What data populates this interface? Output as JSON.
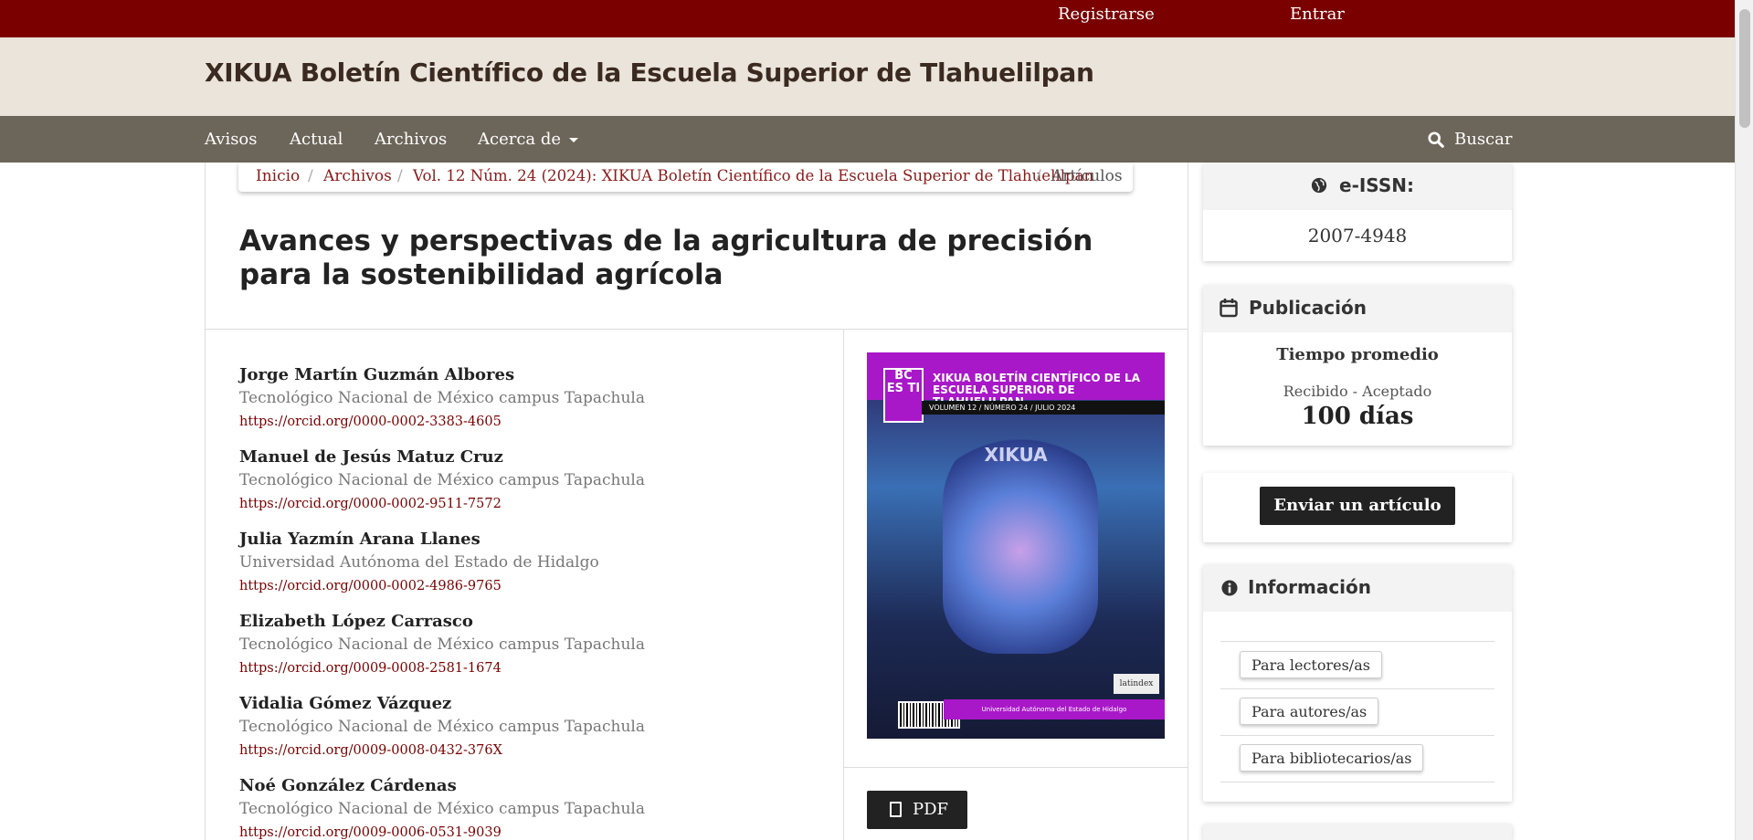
{
  "userbar": {
    "register": "Registrarse",
    "login": "Entrar"
  },
  "header": {
    "title": "XIKUA Boletín Científico de la Escuela Superior de Tlahuelilpan"
  },
  "nav": {
    "items": [
      "Avisos",
      "Actual",
      "Archivos",
      "Acerca de"
    ],
    "search": "Buscar"
  },
  "breadcrumb": {
    "home": "Inicio",
    "archives": "Archivos",
    "issue": "Vol. 12 Núm. 24 (2024): XIKUA Boletín Científico de la Escuela Superior de Tlahuelilpan",
    "current": "Artículos",
    "separator": "/"
  },
  "article": {
    "title": "Avances y perspectivas de la agricultura de precisión para la sostenibilidad agrícola",
    "authors": [
      {
        "name": "Jorge Martín Guzmán Albores",
        "affiliation": "Tecnológico Nacional de México campus Tapachula",
        "orcid": "https://orcid.org/0000-0002-3383-4605"
      },
      {
        "name": "Manuel de Jesús Matuz Cruz",
        "affiliation": "Tecnológico Nacional de México campus Tapachula",
        "orcid": "https://orcid.org/0000-0002-9511-7572"
      },
      {
        "name": "Julia Yazmín Arana Llanes",
        "affiliation": "Universidad Autónoma del Estado de Hidalgo",
        "orcid": "https://orcid.org/0000-0002-4986-9765"
      },
      {
        "name": "Elizabeth López Carrasco",
        "affiliation": "Tecnológico Nacional de México campus Tapachula",
        "orcid": "https://orcid.org/0009-0008-2581-1674"
      },
      {
        "name": "Vidalia Gómez Vázquez",
        "affiliation": "Tecnológico Nacional de México campus Tapachula",
        "orcid": "https://orcid.org/0009-0008-0432-376X"
      },
      {
        "name": "Noé González Cárdenas",
        "affiliation": "Tecnológico Nacional de México campus Tapachula",
        "orcid": "https://orcid.org/0009-0006-0531-9039"
      }
    ]
  },
  "cover": {
    "logo": "BC ES TI",
    "heading": "XIKUA BOLETÍN CIENTÍFICO DE LA ESCUELA SUPERIOR DE TLAHUELILPAN",
    "volume_line": "VOLUMEN 12 / NÚMERO 24 / JULIO 2024",
    "xikua": "XIKUA",
    "bottom": "Universidad Autónoma del Estado de Hidalgo",
    "latindex": "latindex"
  },
  "pdf": {
    "label": "PDF"
  },
  "sidebar": {
    "eissn": {
      "title": "e-ISSN:",
      "value": "2007-4948"
    },
    "publication": {
      "title": "Publicación",
      "subtitle": "Tiempo promedio",
      "caption": "Recibido - Aceptado",
      "value": "100 días"
    },
    "submit": {
      "label": "Enviar un artículo"
    },
    "info": {
      "title": "Información",
      "links": [
        "Para lectores/as",
        "Para autores/as",
        "Para bibliotecarios/as"
      ]
    }
  },
  "colors": {
    "topbar": "#7a0000",
    "header": "#ebe4da",
    "nav": "#6c6559",
    "link": "#7a0000"
  },
  "icons": {
    "search": "search-icon",
    "globe": "globe-icon",
    "calendar": "calendar-icon",
    "info": "info-icon",
    "pdf": "file-pdf-icon",
    "caret": "chevron-down-icon"
  }
}
